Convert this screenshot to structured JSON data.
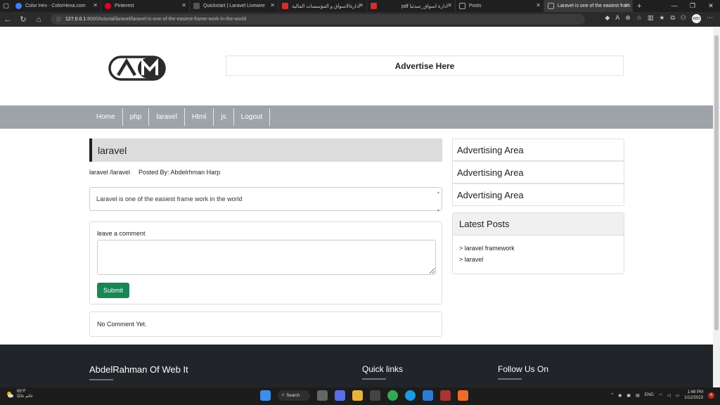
{
  "browser": {
    "tabs": [
      {
        "title": "Color Hex - ColorHexa.com",
        "color": "#3b82f6"
      },
      {
        "title": "Pinterest",
        "color": "#e60023"
      },
      {
        "title": "Quickstart | Laravel Livewire",
        "color": "#555555"
      },
      {
        "title": "ادارةالاسواق و المؤسسات المالية",
        "color": "#d32f2f"
      },
      {
        "title": "pdf ادارة اسواق_مبدئيا",
        "color": "#d32f2f"
      },
      {
        "title": "Posts",
        "color": "#888888"
      },
      {
        "title": "Laravel is one of the easiest fram",
        "color": "#888888"
      }
    ],
    "url_host": "127.0.0.1",
    "url_path": ":8000/tutorial/laravel/laravel-is-one-of-the-easiest-frame-work-in-the-world",
    "avatar_text": "ABD"
  },
  "header": {
    "logo_text": "AM",
    "advert": "Advertise Here"
  },
  "nav": {
    "items": [
      "Home",
      "php",
      "laravel",
      "Html",
      "js",
      "Logout"
    ]
  },
  "post": {
    "title": "laravel",
    "breadcrumb": "laravel /laravel",
    "author": "Posted By: Abdelrhman Harp",
    "body": "Laravel is one of the easiest frame work in the world"
  },
  "comment": {
    "label": "leave a comment",
    "placeholder": "",
    "submit": "Submit",
    "empty": "No Comment Yet."
  },
  "sidebar": {
    "ads": [
      "Advertising Area",
      "Advertising Area",
      "Advertising Area"
    ],
    "latest_title": "Latest Posts",
    "latest": [
      "> laravel framework",
      "> laravel"
    ]
  },
  "footer": {
    "brand": "AbdelRahman Of Web It",
    "quick": "Quick links",
    "follow": "Follow Us On"
  },
  "taskbar": {
    "temp": "65°F",
    "weather_text": "غائم غالبًا",
    "search": "Search",
    "lang": "ENG",
    "time": "1:48 PM",
    "date": "1/12/2023",
    "badge": "4"
  },
  "colors": {
    "nav_bg": "#9da3a8",
    "submit_bg": "#198754",
    "footer_bg": "#212529"
  }
}
